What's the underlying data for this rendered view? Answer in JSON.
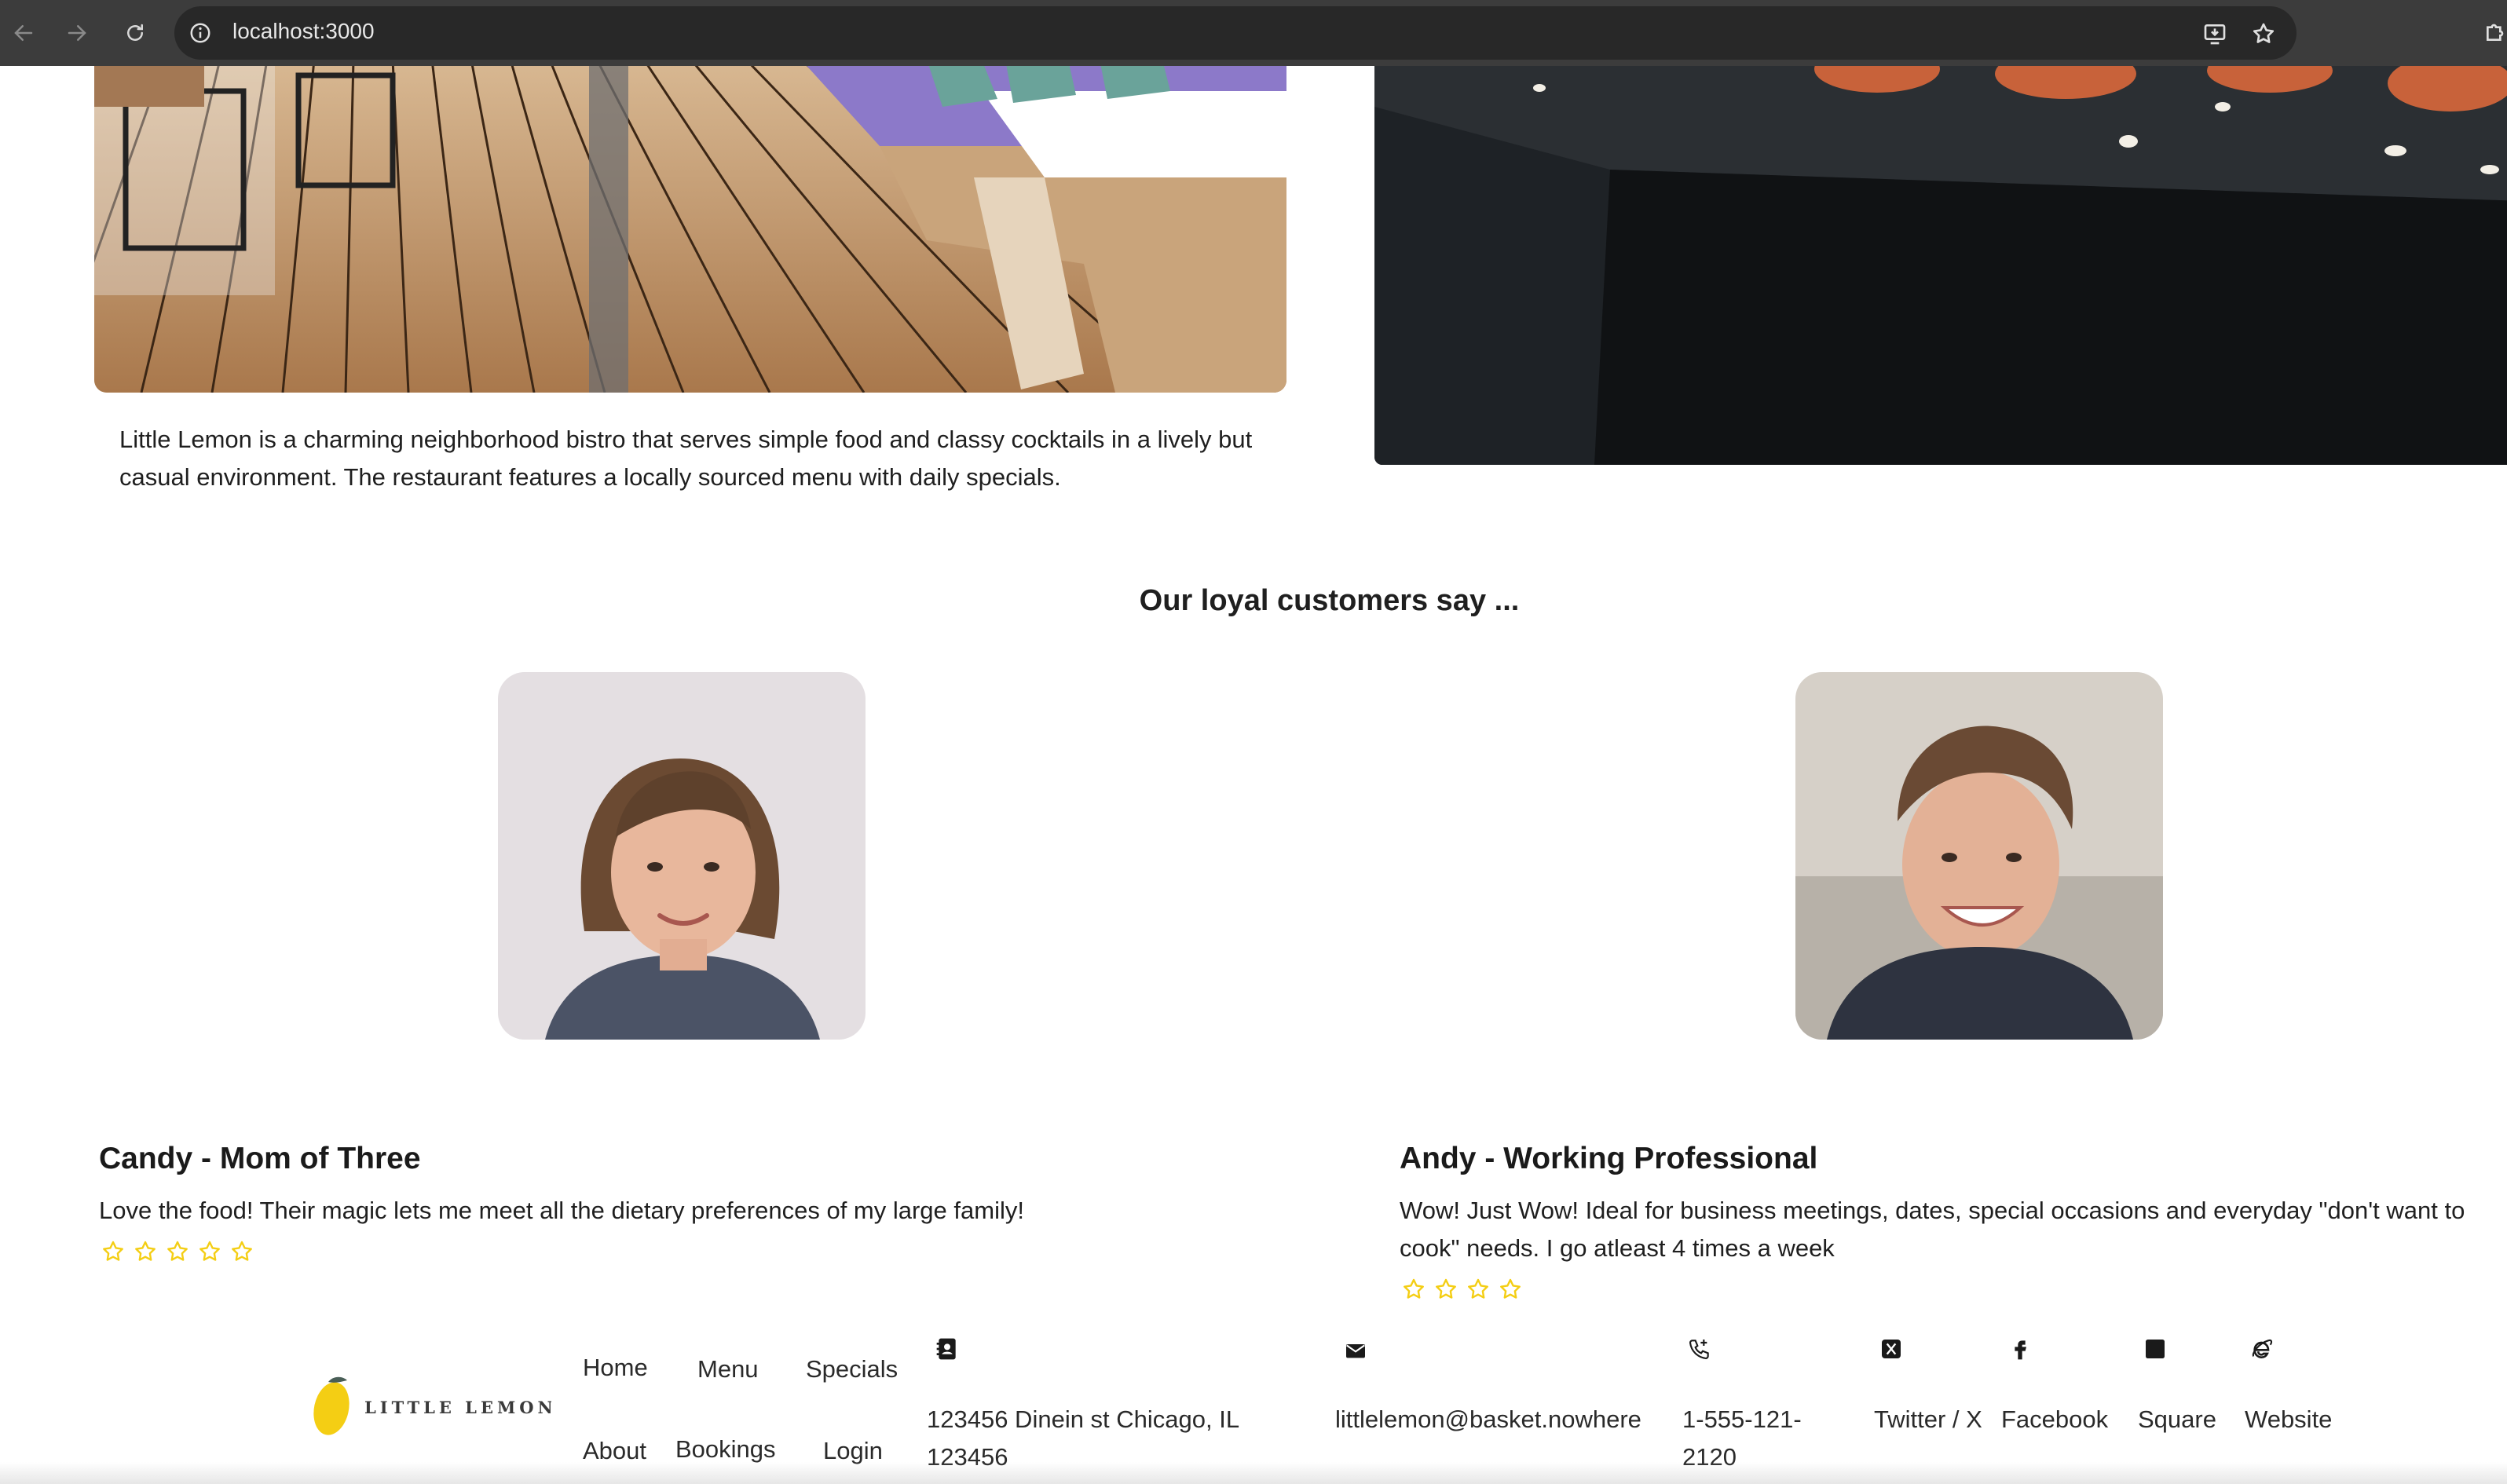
{
  "browser": {
    "url": "localhost:3000",
    "icons": [
      "back-arrow-icon",
      "forward-arrow-icon",
      "reload-icon",
      "site-info-icon",
      "install-app-icon",
      "bookmark-star-icon",
      "extensions-icon"
    ]
  },
  "about": {
    "description": "Little Lemon is a charming neighborhood bistro that serves simple food and classy cocktails in a lively but casual environment. The restaurant features a locally sourced menu with daily specials."
  },
  "testimonials": {
    "heading": "Our loyal customers say ...",
    "items": [
      {
        "name": "Candy - Mom of Three",
        "text": "Love the food! Their magic lets me meet all the dietary preferences of my large family!",
        "rating": 5
      },
      {
        "name": "Andy - Working Professional",
        "text": "Wow! Just Wow! Ideal for business meetings, dates, special occasions and everyday \"don't want to cook\" needs. I go atleast 4 times a week",
        "rating": 4
      }
    ]
  },
  "footer": {
    "logo_text": "LITTLE LEMON",
    "nav": [
      "Home",
      "Menu",
      "Specials",
      "About",
      "Bookings",
      "Login"
    ],
    "address": "123456 Dinein st Chicago, IL 123456",
    "email": "littlelemon@basket.nowhere",
    "phone": "1-555-121-2120",
    "social": [
      "Twitter / X",
      "Facebook",
      "Square",
      "Website"
    ]
  },
  "colors": {
    "star": "#f4ce14",
    "chrome": "#3c3c3c",
    "omnibox": "#282828"
  }
}
